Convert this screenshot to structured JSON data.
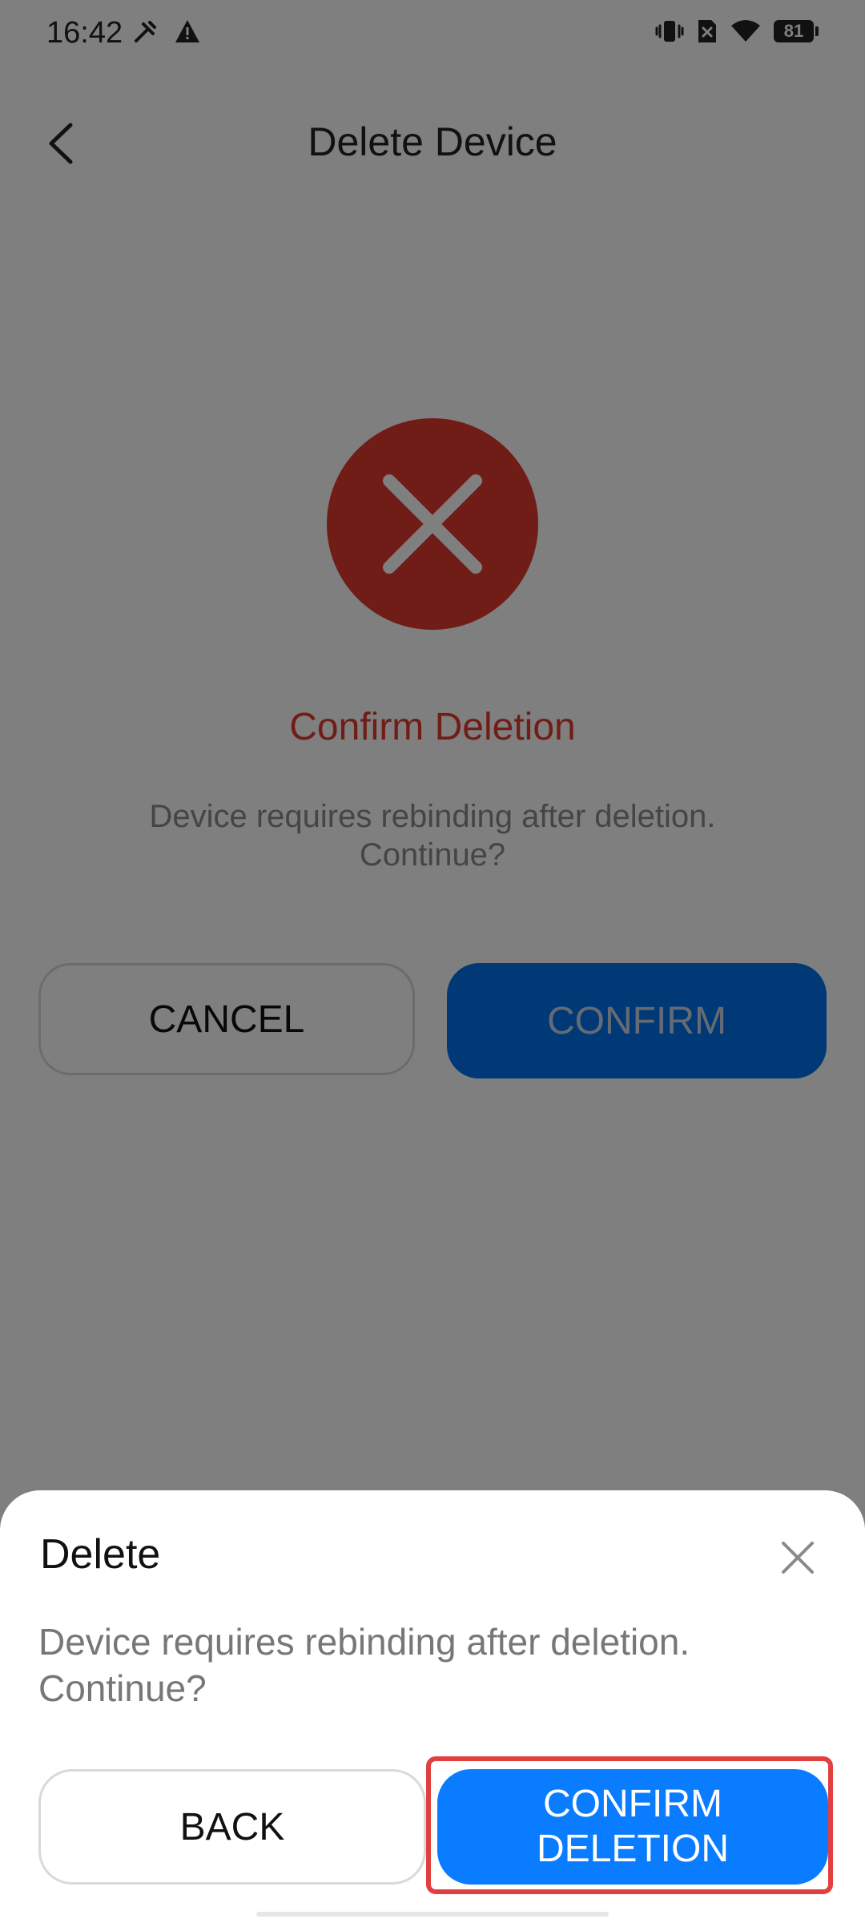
{
  "status_bar": {
    "time": "16:42",
    "battery": "81",
    "icons_left": [
      "tools-icon",
      "warning-icon"
    ],
    "icons_right": [
      "vibrate-icon",
      "no-sim-icon",
      "wifi-icon",
      "battery-icon"
    ]
  },
  "header": {
    "title": "Delete Device",
    "back_icon": "back-arrow-icon"
  },
  "main": {
    "icon": "error-x-icon",
    "title": "Confirm Deletion",
    "message": "Device requires rebinding after deletion. Continue?",
    "cancel_label": "CANCEL",
    "confirm_label": "CONFIRM"
  },
  "sheet": {
    "title": "Delete",
    "close_icon": "close-icon",
    "message": "Device requires rebinding after deletion. Continue?",
    "back_label": "BACK",
    "confirm_deletion_label": "CONFIRM\nDELETION"
  },
  "colors": {
    "accent": "#0a7cff",
    "danger": "#e23a2e",
    "highlight": "#e24040"
  }
}
